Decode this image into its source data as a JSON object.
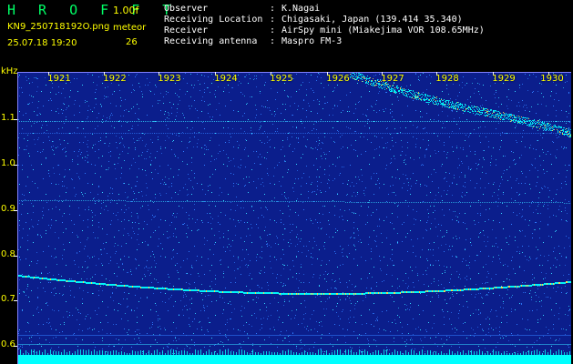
{
  "header": {
    "app_title": "H R O F F T",
    "version": "1.00f",
    "filename": "KN9_250718192O.png",
    "datetime": "25.07.18 19:20",
    "meteor_label": "meteor",
    "meteor_count": "26"
  },
  "station": [
    {
      "label": "Observer",
      "value": "K.Nagai"
    },
    {
      "label": "Receiving Location",
      "value": "Chigasaki, Japan (139.414 35.340)"
    },
    {
      "label": "Receiver",
      "value": "AirSpy mini (Miakejima VOR 108.65MHz)"
    },
    {
      "label": "Receiving antenna",
      "value": "Maspro FM-3"
    }
  ],
  "spectrogram": {
    "y_unit": "kHz",
    "y_ticks": [
      "1.1",
      "1.0",
      "0.9",
      "0.8",
      "0.7",
      "0.6"
    ],
    "x_ticks": [
      "1921",
      "1922",
      "1923",
      "1924",
      "1925",
      "1926",
      "1927",
      "1928",
      "1929",
      "1930"
    ],
    "colors": {
      "background": "#0b1e8c",
      "noise_light": "#2f7cff",
      "noise_mid": "#35d6ff",
      "signal": "#00ffff",
      "hot_signal": "#ffe04a",
      "bottom_band": "#00ffff",
      "axis_text": "#ffff00"
    }
  }
}
